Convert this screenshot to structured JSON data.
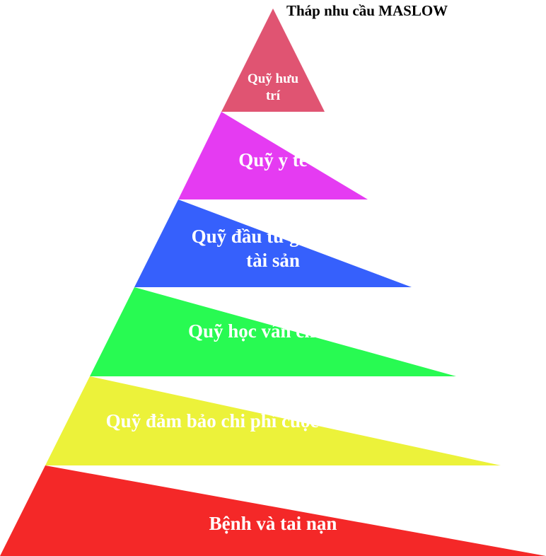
{
  "title": "Tháp nhu cầu MASLOW",
  "levels": [
    {
      "label": "Quỹ hưu\ntrí",
      "color": "#e05472"
    },
    {
      "label": "Quỹ y tế",
      "color": "#e53bf2"
    },
    {
      "label": "Quỹ đầu tư gia tăng\ntài sản",
      "color": "#3660fc"
    },
    {
      "label": "Quỹ học vấn cho con",
      "color": "#28fa52"
    },
    {
      "label": "Quỹ đảm bảo chi phí cuộc sống hằng này",
      "color": "#ecf23a"
    },
    {
      "label": "Bệnh và tai nạn",
      "color": "#f42828"
    }
  ]
}
